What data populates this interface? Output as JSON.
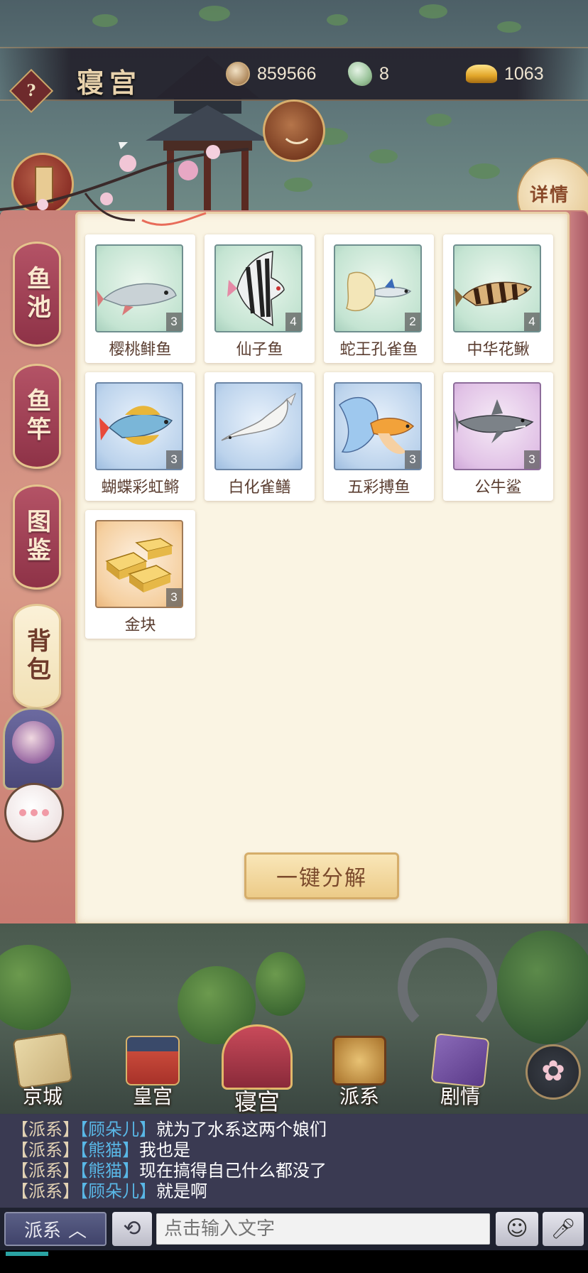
{
  "header": {
    "help_label": "?",
    "title": "寝宫",
    "resources": [
      {
        "icon": "coin-icon",
        "value": "859566"
      },
      {
        "icon": "jade-icon",
        "value": "8"
      },
      {
        "icon": "gold-ingot-icon",
        "value": "1063"
      }
    ],
    "detail_label": "详情"
  },
  "side_tabs": [
    {
      "label": "鱼池",
      "active": false
    },
    {
      "label": "鱼竿",
      "active": false
    },
    {
      "label": "图鉴",
      "active": false
    },
    {
      "label": "背包",
      "active": true
    }
  ],
  "items": [
    {
      "name": "樱桃鲱鱼",
      "count": "3",
      "rarity": "green",
      "icon": "cherry-herring-icon"
    },
    {
      "name": "仙子鱼",
      "count": "4",
      "rarity": "green",
      "icon": "angelfish-icon"
    },
    {
      "name": "蛇王孔雀鱼",
      "count": "2",
      "rarity": "green",
      "icon": "guppy-icon"
    },
    {
      "name": "中华花鳅",
      "count": "4",
      "rarity": "green",
      "icon": "loach-icon"
    },
    {
      "name": "蝴蝶彩虹鳉",
      "count": "3",
      "rarity": "blue",
      "icon": "rainbowfish-icon"
    },
    {
      "name": "白化雀鳝",
      "count": "",
      "rarity": "blue",
      "icon": "albino-gar-icon"
    },
    {
      "name": "五彩搏鱼",
      "count": "3",
      "rarity": "blue",
      "icon": "betta-icon"
    },
    {
      "name": "公牛鲨",
      "count": "3",
      "rarity": "purple",
      "icon": "bull-shark-icon"
    },
    {
      "name": "金块",
      "count": "3",
      "rarity": "orange",
      "icon": "gold-bars-icon"
    }
  ],
  "decompose_label": "一键分解",
  "nav": [
    {
      "label": "京城",
      "icon": "map-icon",
      "active": false
    },
    {
      "label": "皇宫",
      "icon": "palace-icon",
      "active": false
    },
    {
      "label": "寝宫",
      "icon": "bedchamber-icon",
      "active": true
    },
    {
      "label": "派系",
      "icon": "faction-icon",
      "active": false
    },
    {
      "label": "剧情",
      "icon": "book-icon",
      "active": false
    }
  ],
  "chat": {
    "messages": [
      {
        "channel": "【派系】",
        "user": "【顾朵儿】",
        "text": "就为了水系这两个娘们"
      },
      {
        "channel": "【派系】",
        "user": "【熊猫】",
        "text": "我也是"
      },
      {
        "channel": "【派系】",
        "user": "【熊猫】",
        "text": "现在搞得自己什么都没了"
      },
      {
        "channel": "【派系】",
        "user": "【顾朵儿】",
        "text": "就是啊"
      }
    ],
    "channel_label": "派系",
    "input_placeholder": "点击输入文字"
  },
  "colors": {
    "panel_bg": "#faf4e3",
    "tab_inactive": "#a0425a",
    "tab_active": "#f6e9c6",
    "chat_user": "#59b7e6",
    "button_gold": "#eccb88"
  }
}
